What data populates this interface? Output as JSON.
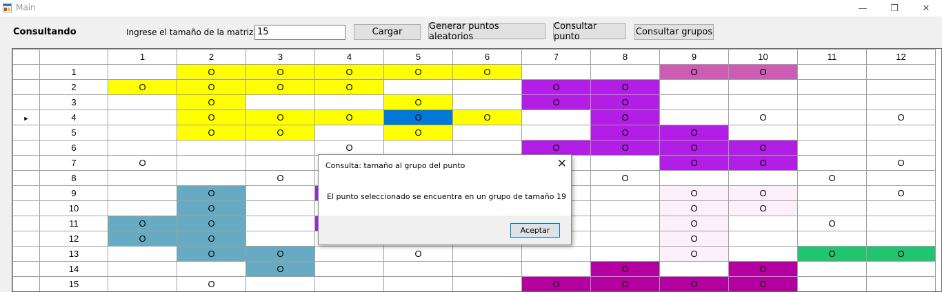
{
  "window": {
    "title": "Main",
    "minimize_glyph": "—",
    "maximize_glyph": "❐",
    "close_glyph": "✕"
  },
  "toolbar": {
    "status_label": "Consultando",
    "size_label": "Ingrese el tamaño de la matriz",
    "size_value": "15",
    "load_button": "Cargar",
    "random_button": "Generar puntos aleatorios",
    "query_point_button": "Consultar punto",
    "query_groups_button": "Consultar grupos"
  },
  "grid": {
    "columns": [
      "1",
      "2",
      "3",
      "4",
      "5",
      "6",
      "7",
      "8",
      "9",
      "10",
      "11",
      "12"
    ],
    "selected_row_marker": "►",
    "selected_row": 4,
    "colors": {
      "Y": "#ffff00",
      "V": "#b31ee6",
      "P": "#cd5cb4",
      "B": "#0078d7",
      "T": "#67abc2",
      "L": "#fdf0fa",
      "G": "#21c56f",
      "M": "#b400a0",
      "I": "#9a2fd8",
      "W": "#ffffff"
    },
    "rows": [
      {
        "label": "1",
        "cells": [
          [
            "",
            ""
          ],
          [
            "O",
            "Y"
          ],
          [
            "O",
            "Y"
          ],
          [
            "O",
            "Y"
          ],
          [
            "O",
            "Y"
          ],
          [
            "O",
            "Y"
          ],
          [
            "",
            ""
          ],
          [
            "",
            ""
          ],
          [
            "O",
            "P"
          ],
          [
            "O",
            "P"
          ],
          [
            "",
            ""
          ],
          [
            "",
            ""
          ]
        ]
      },
      {
        "label": "2",
        "cells": [
          [
            "O",
            "Y"
          ],
          [
            "O",
            "Y"
          ],
          [
            "O",
            "Y"
          ],
          [
            "O",
            "Y"
          ],
          [
            "",
            ""
          ],
          [
            "",
            ""
          ],
          [
            "O",
            "V"
          ],
          [
            "O",
            "V"
          ],
          [
            "",
            ""
          ],
          [
            "",
            ""
          ],
          [
            "",
            ""
          ],
          [
            "",
            ""
          ]
        ]
      },
      {
        "label": "3",
        "cells": [
          [
            "",
            ""
          ],
          [
            "O",
            "Y"
          ],
          [
            "",
            ""
          ],
          [
            "",
            ""
          ],
          [
            "O",
            "Y"
          ],
          [
            "",
            ""
          ],
          [
            "O",
            "V"
          ],
          [
            "O",
            "V"
          ],
          [
            "",
            ""
          ],
          [
            "",
            ""
          ],
          [
            "",
            ""
          ],
          [
            "",
            ""
          ]
        ]
      },
      {
        "label": "4",
        "cells": [
          [
            "",
            ""
          ],
          [
            "O",
            "Y"
          ],
          [
            "O",
            "Y"
          ],
          [
            "O",
            "Y"
          ],
          [
            "O",
            "B"
          ],
          [
            "O",
            "Y"
          ],
          [
            "",
            ""
          ],
          [
            "O",
            "V"
          ],
          [
            "",
            ""
          ],
          [
            "O",
            "W"
          ],
          [
            "",
            ""
          ],
          [
            "O",
            "W"
          ]
        ]
      },
      {
        "label": "5",
        "cells": [
          [
            "",
            ""
          ],
          [
            "O",
            "Y"
          ],
          [
            "O",
            "Y"
          ],
          [
            "",
            ""
          ],
          [
            "O",
            "Y"
          ],
          [
            "",
            ""
          ],
          [
            "",
            ""
          ],
          [
            "O",
            "V"
          ],
          [
            "O",
            "V"
          ],
          [
            "",
            ""
          ],
          [
            "",
            ""
          ],
          [
            "",
            ""
          ]
        ]
      },
      {
        "label": "6",
        "cells": [
          [
            "",
            ""
          ],
          [
            "",
            ""
          ],
          [
            "",
            ""
          ],
          [
            "O",
            "W"
          ],
          [
            "",
            ""
          ],
          [
            "",
            ""
          ],
          [
            "O",
            "V"
          ],
          [
            "O",
            "V"
          ],
          [
            "O",
            "V"
          ],
          [
            "O",
            "V"
          ],
          [
            "",
            ""
          ],
          [
            "",
            ""
          ]
        ]
      },
      {
        "label": "7",
        "cells": [
          [
            "O",
            "W"
          ],
          [
            "",
            ""
          ],
          [
            "",
            ""
          ],
          [
            "",
            ""
          ],
          [
            "",
            ""
          ],
          [
            "",
            ""
          ],
          [
            "",
            ""
          ],
          [
            "",
            ""
          ],
          [
            "O",
            "V"
          ],
          [
            "O",
            "V"
          ],
          [
            "",
            ""
          ],
          [
            "O",
            "W"
          ]
        ]
      },
      {
        "label": "8",
        "cells": [
          [
            "",
            ""
          ],
          [
            "",
            ""
          ],
          [
            "O",
            "W"
          ],
          [
            "",
            ""
          ],
          [
            "",
            ""
          ],
          [
            "",
            ""
          ],
          [
            "",
            ""
          ],
          [
            "O",
            "W"
          ],
          [
            "",
            ""
          ],
          [
            "",
            ""
          ],
          [
            "O",
            "W"
          ],
          [
            "",
            ""
          ]
        ]
      },
      {
        "label": "9",
        "cells": [
          [
            "",
            ""
          ],
          [
            "O",
            "T"
          ],
          [
            "",
            ""
          ],
          [
            "",
            "I"
          ],
          [
            "",
            ""
          ],
          [
            "",
            ""
          ],
          [
            "",
            ""
          ],
          [
            "",
            ""
          ],
          [
            "O",
            "L"
          ],
          [
            "O",
            "L"
          ],
          [
            "",
            ""
          ],
          [
            "O",
            "W"
          ]
        ]
      },
      {
        "label": "10",
        "cells": [
          [
            "",
            ""
          ],
          [
            "O",
            "T"
          ],
          [
            "",
            ""
          ],
          [
            "",
            ""
          ],
          [
            "",
            ""
          ],
          [
            "",
            ""
          ],
          [
            "",
            ""
          ],
          [
            "",
            ""
          ],
          [
            "O",
            "L"
          ],
          [
            "O",
            "L"
          ],
          [
            "",
            ""
          ],
          [
            "",
            ""
          ]
        ]
      },
      {
        "label": "11",
        "cells": [
          [
            "O",
            "T"
          ],
          [
            "O",
            "T"
          ],
          [
            "",
            ""
          ],
          [
            "",
            "I"
          ],
          [
            "",
            ""
          ],
          [
            "",
            ""
          ],
          [
            "",
            ""
          ],
          [
            "",
            ""
          ],
          [
            "O",
            "L"
          ],
          [
            "",
            ""
          ],
          [
            "O",
            "W"
          ],
          [
            "",
            ""
          ]
        ]
      },
      {
        "label": "12",
        "cells": [
          [
            "O",
            "T"
          ],
          [
            "O",
            "T"
          ],
          [
            "",
            ""
          ],
          [
            "",
            ""
          ],
          [
            "",
            ""
          ],
          [
            "",
            ""
          ],
          [
            "",
            ""
          ],
          [
            "",
            ""
          ],
          [
            "O",
            "L"
          ],
          [
            "",
            ""
          ],
          [
            "",
            ""
          ],
          [
            "",
            ""
          ]
        ]
      },
      {
        "label": "13",
        "cells": [
          [
            "",
            ""
          ],
          [
            "O",
            "T"
          ],
          [
            "O",
            "T"
          ],
          [
            "",
            ""
          ],
          [
            "O",
            "W"
          ],
          [
            "",
            ""
          ],
          [
            "",
            ""
          ],
          [
            "",
            ""
          ],
          [
            "O",
            "L"
          ],
          [
            "",
            ""
          ],
          [
            "O",
            "G"
          ],
          [
            "O",
            "G"
          ]
        ]
      },
      {
        "label": "14",
        "cells": [
          [
            "",
            ""
          ],
          [
            "",
            ""
          ],
          [
            "O",
            "T"
          ],
          [
            "",
            ""
          ],
          [
            "",
            ""
          ],
          [
            "",
            ""
          ],
          [
            "",
            ""
          ],
          [
            "O",
            "M"
          ],
          [
            "",
            ""
          ],
          [
            "O",
            "M"
          ],
          [
            "",
            ""
          ],
          [
            "",
            ""
          ]
        ]
      },
      {
        "label": "15",
        "cells": [
          [
            "",
            ""
          ],
          [
            "O",
            "W"
          ],
          [
            "",
            ""
          ],
          [
            "",
            ""
          ],
          [
            "",
            ""
          ],
          [
            "",
            ""
          ],
          [
            "O",
            "M"
          ],
          [
            "O",
            "M"
          ],
          [
            "O",
            "M"
          ],
          [
            "O",
            "M"
          ],
          [
            "",
            ""
          ],
          [
            "",
            ""
          ]
        ]
      }
    ]
  },
  "dialog": {
    "title": "Consulta: tamaño al grupo del punto",
    "message": "El punto seleccionado se encuentra en un grupo de tamaño 19",
    "ok_button": "Aceptar",
    "close_glyph": "✕"
  }
}
